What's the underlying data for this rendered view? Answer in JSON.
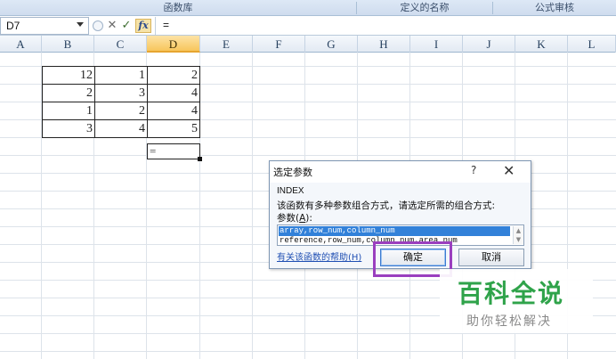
{
  "ribbon": {
    "groups": [
      {
        "label": "函数库"
      },
      {
        "label": "定义的名称"
      },
      {
        "label": "公式审核"
      }
    ]
  },
  "formula_bar": {
    "name_box": "D7",
    "cancel_glyph": "✕",
    "enter_glyph": "✓",
    "fx_label": "fx",
    "content": "="
  },
  "columns": [
    "A",
    "B",
    "C",
    "D",
    "E",
    "F",
    "G",
    "H",
    "I",
    "J",
    "K",
    "L"
  ],
  "active_column": "D",
  "table": {
    "rows": [
      [
        "12",
        "1",
        "2"
      ],
      [
        "2",
        "3",
        "4"
      ],
      [
        "1",
        "2",
        "4"
      ],
      [
        "3",
        "4",
        "5"
      ]
    ]
  },
  "active_cell": {
    "content": "="
  },
  "dialog": {
    "title": "选定参数",
    "help_glyph": "?",
    "close_glyph": "✕",
    "function_name": "INDEX",
    "description": "该函数有多种参数组合方式，请选定所需的组合方式:",
    "params_label_pre": "参数(",
    "params_label_key": "A",
    "params_label_post": "):",
    "options": [
      "array,row_num,column_num",
      "reference,row_num,column_num,area_num"
    ],
    "help_link": "有关该函数的帮助(H)",
    "ok_label": "确定",
    "cancel_label": "取消"
  },
  "watermark": {
    "title": "百科全说",
    "subtitle": "助你轻松解决"
  },
  "colors": {
    "selection": "#3281d9",
    "highlight": "#9a3fbf",
    "watermark_green": "#2fa34a"
  }
}
